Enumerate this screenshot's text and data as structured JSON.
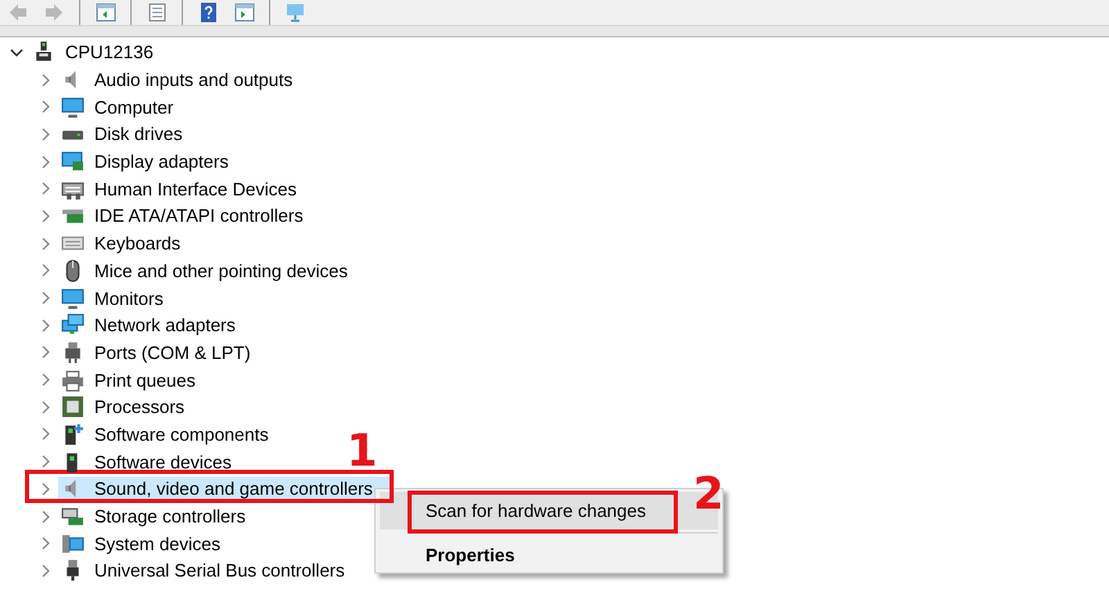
{
  "toolbar": {
    "buttons": [
      {
        "kind": "back",
        "disabled": true
      },
      {
        "kind": "forward",
        "disabled": true
      },
      {
        "kind": "sep"
      },
      {
        "kind": "panel"
      },
      {
        "kind": "sep"
      },
      {
        "kind": "props"
      },
      {
        "kind": "sep"
      },
      {
        "kind": "help"
      },
      {
        "kind": "panel2"
      },
      {
        "kind": "sep"
      },
      {
        "kind": "monitor"
      }
    ]
  },
  "tree": {
    "label": "CPU12136",
    "expanded": true,
    "children": [
      {
        "label": "Audio inputs and outputs",
        "expanded": false,
        "selected": false
      },
      {
        "label": "Computer",
        "expanded": false,
        "selected": false
      },
      {
        "label": "Disk drives",
        "expanded": false,
        "selected": false
      },
      {
        "label": "Display adapters",
        "expanded": false,
        "selected": false
      },
      {
        "label": "Human Interface Devices",
        "expanded": false,
        "selected": false
      },
      {
        "label": "IDE ATA/ATAPI controllers",
        "expanded": false,
        "selected": false
      },
      {
        "label": "Keyboards",
        "expanded": false,
        "selected": false
      },
      {
        "label": "Mice and other pointing devices",
        "expanded": false,
        "selected": false
      },
      {
        "label": "Monitors",
        "expanded": false,
        "selected": false
      },
      {
        "label": "Network adapters",
        "expanded": false,
        "selected": false
      },
      {
        "label": "Ports (COM & LPT)",
        "expanded": false,
        "selected": false
      },
      {
        "label": "Print queues",
        "expanded": false,
        "selected": false
      },
      {
        "label": "Processors",
        "expanded": false,
        "selected": false
      },
      {
        "label": "Software components",
        "expanded": false,
        "selected": false
      },
      {
        "label": "Software devices",
        "expanded": false,
        "selected": false
      },
      {
        "label": "Sound, video and game controllers",
        "expanded": false,
        "selected": true
      },
      {
        "label": "Storage controllers",
        "expanded": false,
        "selected": false
      },
      {
        "label": "System devices",
        "expanded": false,
        "selected": false
      },
      {
        "label": "Universal Serial Bus controllers",
        "expanded": false,
        "selected": false
      }
    ]
  },
  "context_menu": {
    "items": [
      {
        "label": "Scan for hardware changes",
        "kind": "action",
        "selected": true
      },
      {
        "kind": "separator"
      },
      {
        "label": "Properties",
        "kind": "default",
        "selected": false
      }
    ]
  },
  "annotations": [
    {
      "label": "1",
      "kind": "row"
    },
    {
      "label": "2",
      "kind": "menu"
    }
  ]
}
